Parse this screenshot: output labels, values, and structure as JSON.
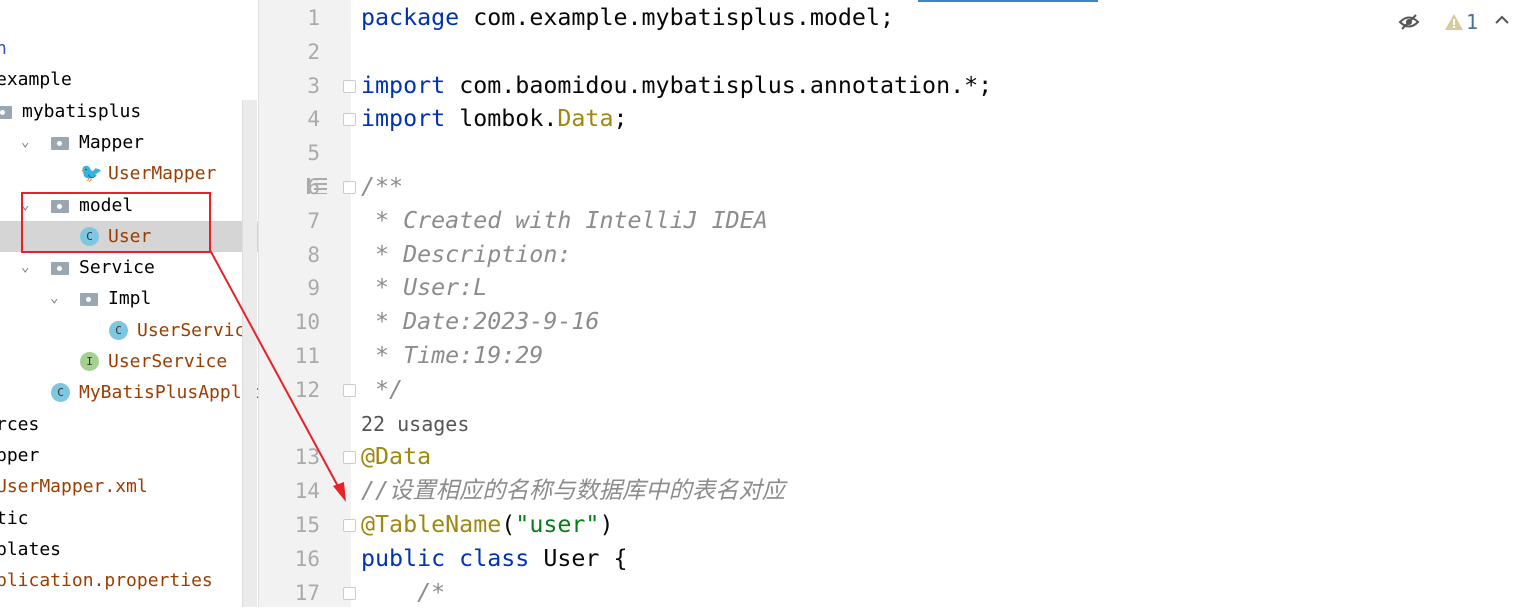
{
  "tree": [
    {
      "label": "n",
      "indent": -1,
      "kind": "text",
      "color": "blue"
    },
    {
      "label": "example",
      "indent": -1,
      "kind": "text"
    },
    {
      "label": "mybatisplus",
      "indent": 0,
      "kind": "folder"
    },
    {
      "label": "Mapper",
      "indent": 1,
      "kind": "folder",
      "chev": true
    },
    {
      "label": "UserMapper",
      "indent": 2,
      "kind": "mapper",
      "color": "orange"
    },
    {
      "label": "model",
      "indent": 1,
      "kind": "folder",
      "chev": true
    },
    {
      "label": "User",
      "indent": 2,
      "kind": "class",
      "color": "orange",
      "selected": true
    },
    {
      "label": "Service",
      "indent": 1,
      "kind": "folder",
      "chev": true
    },
    {
      "label": "Impl",
      "indent": 2,
      "kind": "folder",
      "chev": true
    },
    {
      "label": "UserServiceImpl",
      "indent": 3,
      "kind": "class",
      "color": "orange"
    },
    {
      "label": "UserService",
      "indent": 2,
      "kind": "interface",
      "color": "orange"
    },
    {
      "label": "MyBatisPlusApplication",
      "indent": 1,
      "kind": "app",
      "color": "orange"
    },
    {
      "label": "rces",
      "indent": -1,
      "kind": "text"
    },
    {
      "label": "pper",
      "indent": -1,
      "kind": "text"
    },
    {
      "label": "UserMapper.xml",
      "indent": -1,
      "kind": "text",
      "color": "orange"
    },
    {
      "label": "tic",
      "indent": -1,
      "kind": "text"
    },
    {
      "label": "plates",
      "indent": -1,
      "kind": "text"
    },
    {
      "label": "plication.properties",
      "indent": -1,
      "kind": "text",
      "color": "orange"
    }
  ],
  "editor": {
    "lines": [
      {
        "n": "1",
        "parts": [
          [
            "kw",
            "package "
          ],
          [
            "",
            "com.example.mybatisplus.model;"
          ]
        ]
      },
      {
        "n": "2",
        "parts": []
      },
      {
        "n": "3",
        "parts": [
          [
            "kw",
            "import "
          ],
          [
            "",
            "com.baomidou.mybatisplus.annotation.*;"
          ]
        ],
        "fold": true
      },
      {
        "n": "4",
        "parts": [
          [
            "kw",
            "import "
          ],
          [
            "",
            "lombok."
          ],
          [
            "ann",
            "Data"
          ],
          [
            "",
            ";"
          ]
        ],
        "fold": true
      },
      {
        "n": "5",
        "parts": []
      },
      {
        "n": "6",
        "parts": [
          [
            "cm",
            "/**"
          ]
        ],
        "fold": true
      },
      {
        "n": "7",
        "parts": [
          [
            "cm",
            " * Created with IntelliJ IDEA"
          ]
        ]
      },
      {
        "n": "8",
        "parts": [
          [
            "cm",
            " * Description:"
          ]
        ]
      },
      {
        "n": "9",
        "parts": [
          [
            "cm",
            " * User:L"
          ]
        ]
      },
      {
        "n": "10",
        "parts": [
          [
            "cm",
            " * Date:2023-9-16"
          ]
        ]
      },
      {
        "n": "11",
        "parts": [
          [
            "cm",
            " * Time:19:29"
          ]
        ]
      },
      {
        "n": "12",
        "parts": [
          [
            "cm",
            " */"
          ]
        ],
        "fold": true
      },
      {
        "n": "",
        "parts": [
          [
            "usg",
            "22 usages"
          ]
        ]
      },
      {
        "n": "13",
        "parts": [
          [
            "ann",
            "@Data"
          ]
        ],
        "fold": true
      },
      {
        "n": "14",
        "parts": [
          [
            "cm",
            "//设置相应的名称与数据库中的表名对应"
          ]
        ]
      },
      {
        "n": "15",
        "parts": [
          [
            "ann",
            "@TableName"
          ],
          [
            "",
            "("
          ],
          [
            "str",
            "\"user\""
          ],
          [
            "",
            ")"
          ]
        ],
        "fold": true
      },
      {
        "n": "16",
        "parts": [
          [
            "kw",
            "public class "
          ],
          [
            "",
            "User {"
          ]
        ]
      },
      {
        "n": "17",
        "parts": [
          [
            "cm",
            "    /*"
          ]
        ],
        "fold": true
      }
    ]
  },
  "inspections": {
    "warning_count": "1",
    "icons": [
      "eye-crossed-icon",
      "warning-icon",
      "chevron-up-icon"
    ]
  }
}
